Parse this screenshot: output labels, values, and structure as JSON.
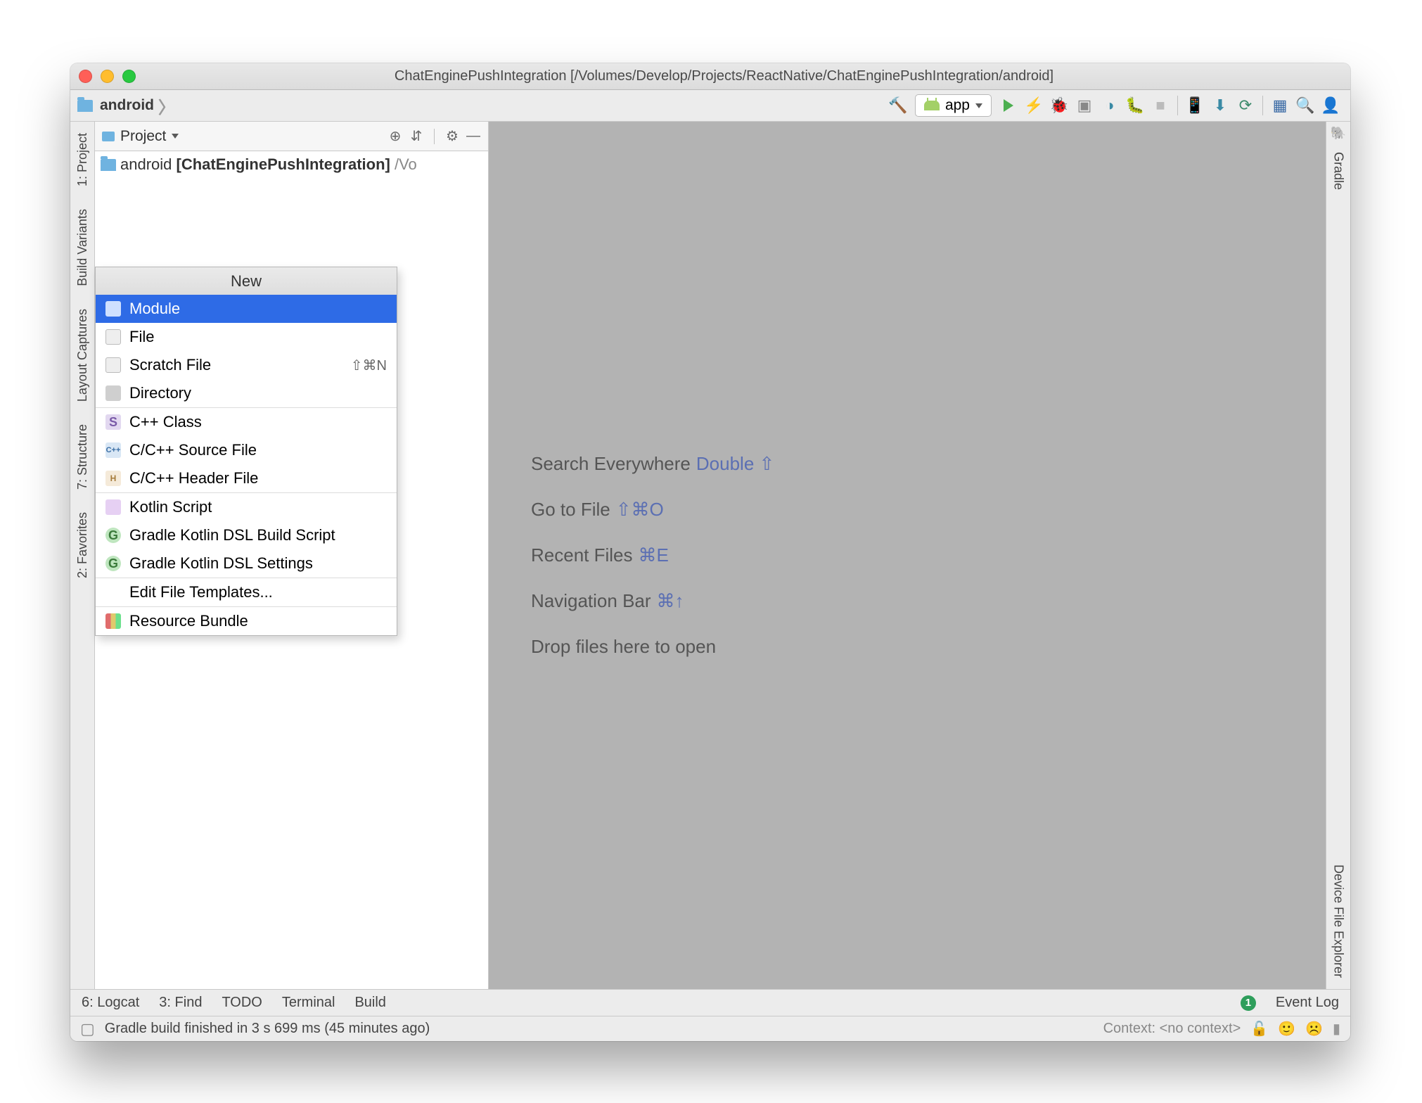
{
  "titlebar": "ChatEnginePushIntegration [/Volumes/Develop/Projects/ReactNative/ChatEnginePushIntegration/android]",
  "breadcrumb": {
    "root": "android"
  },
  "run_config": "app",
  "panel": {
    "title": "Project"
  },
  "tree": {
    "name": "android",
    "bold": "[ChatEnginePushIntegration]",
    "path": "/Vo"
  },
  "ctx": {
    "header": "New",
    "items1": [
      {
        "label": "Module",
        "shortcut": "",
        "ic": "module",
        "sel": true
      },
      {
        "label": "File",
        "shortcut": "",
        "ic": "file"
      },
      {
        "label": "Scratch File",
        "shortcut": "⇧⌘N",
        "ic": "file"
      },
      {
        "label": "Directory",
        "shortcut": "",
        "ic": "dir"
      }
    ],
    "items2": [
      {
        "label": "C++ Class",
        "ic": "s",
        "glyph": "S"
      },
      {
        "label": "C/C++ Source File",
        "ic": "cpp",
        "glyph": "C++"
      },
      {
        "label": "C/C++ Header File",
        "ic": "h",
        "glyph": "H"
      }
    ],
    "items3": [
      {
        "label": "Kotlin Script",
        "ic": "k"
      },
      {
        "label": "Gradle Kotlin DSL Build Script",
        "ic": "g",
        "glyph": "G"
      },
      {
        "label": "Gradle Kotlin DSL Settings",
        "ic": "g",
        "glyph": "G"
      }
    ],
    "items4": [
      {
        "label": "Edit File Templates...",
        "ic": ""
      }
    ],
    "items5": [
      {
        "label": "Resource Bundle",
        "ic": "rb"
      }
    ]
  },
  "hints": [
    {
      "text": "Search Everywhere ",
      "sc": "Double ⇧"
    },
    {
      "text": "Go to File ",
      "sc": "⇧⌘O"
    },
    {
      "text": "Recent Files ",
      "sc": "⌘E"
    },
    {
      "text": "Navigation Bar ",
      "sc": "⌘↑"
    },
    {
      "text": "Drop files here to open",
      "sc": ""
    }
  ],
  "left_strip": [
    "1: Project",
    "Build Variants",
    "Layout Captures",
    "7: Structure",
    "2: Favorites"
  ],
  "right_strip": [
    "Gradle",
    "Device File Explorer"
  ],
  "bottom_tabs": [
    "6: Logcat",
    "3: Find",
    "TODO",
    "Terminal",
    "Build"
  ],
  "event_log": "Event Log",
  "status": {
    "msg": "Gradle build finished in 3 s 699 ms (45 minutes ago)",
    "context": "Context: <no context>"
  }
}
